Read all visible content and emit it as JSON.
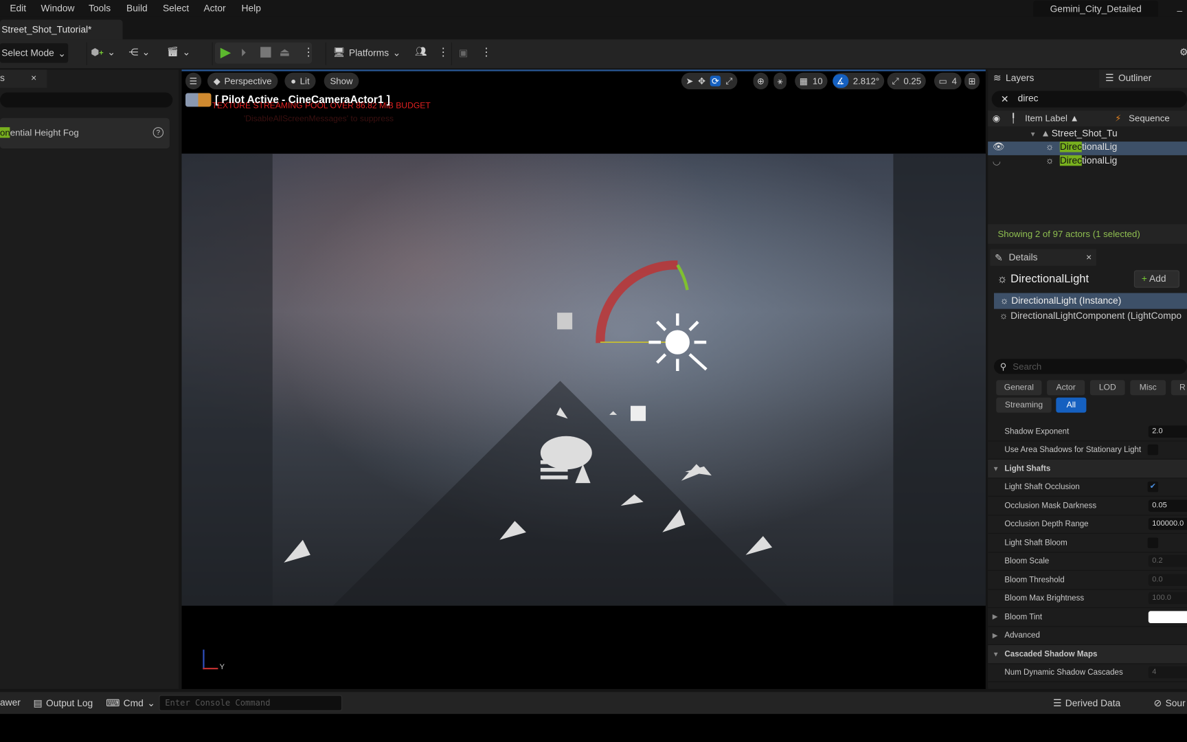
{
  "menu": [
    "Edit",
    "Window",
    "Tools",
    "Build",
    "Select",
    "Actor",
    "Help"
  ],
  "project_name": "Gemini_City_Detailed",
  "doc_tab": "Street_Shot_Tutorial*",
  "toolbar": {
    "select_mode": "Select Mode",
    "platforms": "Platforms"
  },
  "left_panel": {
    "tab": "s",
    "close": "×",
    "item_highlight": "on",
    "item_rest": "ential Height Fog",
    "help": "?"
  },
  "viewport": {
    "perspective": "Perspective",
    "lit": "Lit",
    "show": "Show",
    "grid": "10",
    "angle": "2.812°",
    "scale": "0.25",
    "camera_speed": "4",
    "pilot": "[ Pilot Active - CineCameraActor1 ]",
    "warning": "TEXTURE STREAMING POOL OVER 86.82 MiB BUDGET",
    "warning_sub": "'DisableAllScreenMessages' to suppress",
    "axis": "Y"
  },
  "outliner": {
    "tab_layers": "Layers",
    "tab_outliner": "Outliner",
    "search": "direc",
    "col_label": "Item Label ▲",
    "col_seq": "Sequence",
    "folder": "Street_Shot_Tu",
    "rows": [
      {
        "match": "Direc",
        "rest": "tionalLig"
      },
      {
        "match": "Direc",
        "rest": "tionalLig"
      }
    ],
    "status": "Showing 2 of 97 actors (1 selected)"
  },
  "details": {
    "tab": "Details",
    "close": "×",
    "actor": "DirectionalLight",
    "add": "Add",
    "instance": "DirectionalLight (Instance)",
    "component": "DirectionalLightComponent (LightCompo",
    "search_placeholder": "Search",
    "filters": [
      "General",
      "Actor",
      "LOD",
      "Misc",
      "R",
      "Streaming",
      "All"
    ],
    "props": [
      {
        "label": "Shadow Exponent",
        "value": "2.0"
      },
      {
        "label": "Use Area Shadows for Stationary Light",
        "check": false
      },
      {
        "label": "Light Shafts",
        "category": true
      },
      {
        "label": "Light Shaft Occlusion",
        "check": true
      },
      {
        "label": "Occlusion Mask Darkness",
        "value": "0.05"
      },
      {
        "label": "Occlusion Depth Range",
        "value": "100000.0"
      },
      {
        "label": "Light Shaft Bloom",
        "check": false
      },
      {
        "label": "Bloom Scale",
        "value": "0.2",
        "dim": true
      },
      {
        "label": "Bloom Threshold",
        "value": "0.0",
        "dim": true
      },
      {
        "label": "Bloom Max Brightness",
        "value": "100.0",
        "dim": true
      },
      {
        "label": "Bloom Tint",
        "color": "#ffffff",
        "collapsed": true
      },
      {
        "label": "Advanced",
        "collapsed": true
      },
      {
        "label": "Cascaded Shadow Maps",
        "category": true
      },
      {
        "label": "Num Dynamic Shadow Cascades",
        "value": "4",
        "dim": true
      }
    ]
  },
  "bottom": {
    "drawer": "awer",
    "output_log": "Output Log",
    "cmd": "Cmd",
    "console_placeholder": "Enter Console Command",
    "derived": "Derived Data",
    "source": "Sour"
  },
  "colors": {
    "accent": "#1560c0",
    "highlight": "#78b01e",
    "status": "#8fbf50",
    "warning": "#e02020"
  }
}
